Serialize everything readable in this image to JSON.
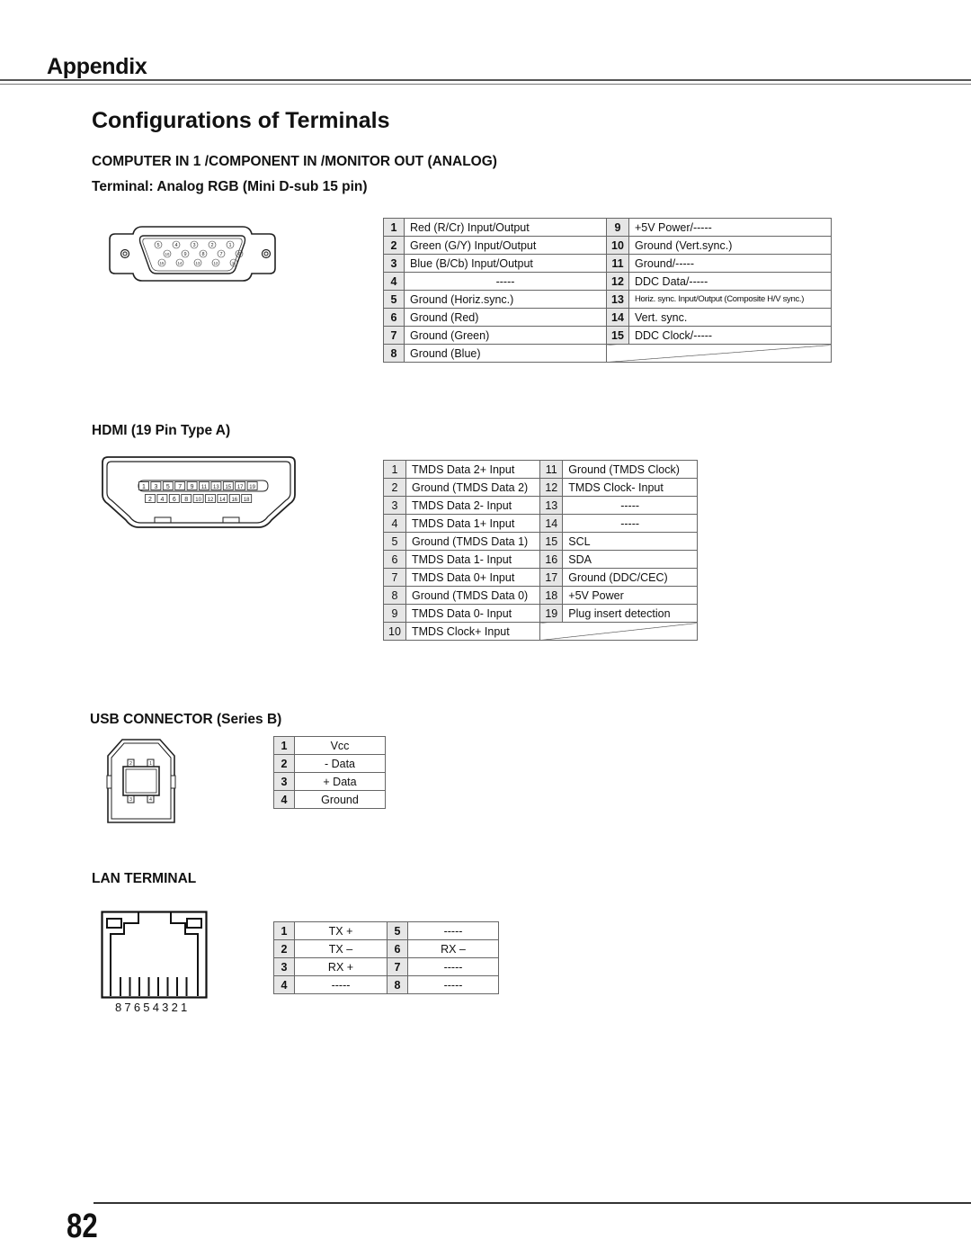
{
  "header": {
    "title": "Appendix"
  },
  "page": {
    "section_title": "Configurations of Terminals",
    "page_number": "82"
  },
  "vga": {
    "heading": "COMPUTER IN 1 /COMPONENT IN /MONITOR OUT (ANALOG)",
    "subheading": "Terminal: Analog RGB (Mini D-sub 15 pin)",
    "connector_icon": "vga-dsub15-connector-icon",
    "pin_labels_row1": [
      "5",
      "4",
      "3",
      "2",
      "1"
    ],
    "pin_labels_row2": [
      "10",
      "9",
      "8",
      "7",
      "6"
    ],
    "pin_labels_row3": [
      "15",
      "14",
      "13",
      "12",
      "11"
    ],
    "rows": [
      {
        "l_num": "1",
        "l_desc": "Red (R/Cr) Input/Output",
        "r_num": "9",
        "r_desc": "+5V Power/-----"
      },
      {
        "l_num": "2",
        "l_desc": "Green (G/Y) Input/Output",
        "r_num": "10",
        "r_desc": "Ground (Vert.sync.)"
      },
      {
        "l_num": "3",
        "l_desc": "Blue (B/Cb) Input/Output",
        "r_num": "11",
        "r_desc": "Ground/-----"
      },
      {
        "l_num": "4",
        "l_desc": "-----",
        "r_num": "12",
        "r_desc": "DDC Data/-----"
      },
      {
        "l_num": "5",
        "l_desc": "Ground (Horiz.sync.)",
        "r_num": "13",
        "r_desc": "Horiz. sync. Input/Output (Composite H/V sync.)"
      },
      {
        "l_num": "6",
        "l_desc": "Ground (Red)",
        "r_num": "14",
        "r_desc": "Vert. sync."
      },
      {
        "l_num": "7",
        "l_desc": "Ground (Green)",
        "r_num": "15",
        "r_desc": "DDC Clock/-----"
      },
      {
        "l_num": "8",
        "l_desc": "Ground (Blue)",
        "r_num": "",
        "r_desc": ""
      }
    ]
  },
  "hdmi": {
    "heading": "HDMI (19 Pin Type A)",
    "connector_icon": "hdmi-type-a-connector-icon",
    "pins_top": [
      "1",
      "3",
      "5",
      "7",
      "9",
      "11",
      "13",
      "15",
      "17",
      "19"
    ],
    "pins_bottom": [
      "2",
      "4",
      "6",
      "8",
      "10",
      "12",
      "14",
      "16",
      "18"
    ],
    "rows": [
      {
        "l_num": "1",
        "l_desc": "TMDS Data 2+  Input",
        "r_num": "11",
        "r_desc": "Ground (TMDS Clock)"
      },
      {
        "l_num": "2",
        "l_desc": "Ground (TMDS Data 2)",
        "r_num": "12",
        "r_desc": "TMDS Clock- Input"
      },
      {
        "l_num": "3",
        "l_desc": "TMDS Data 2- Input",
        "r_num": "13",
        "r_desc": "-----"
      },
      {
        "l_num": "4",
        "l_desc": "TMDS Data 1+ Input",
        "r_num": "14",
        "r_desc": "-----"
      },
      {
        "l_num": "5",
        "l_desc": "Ground (TMDS Data 1)",
        "r_num": "15",
        "r_desc": "SCL"
      },
      {
        "l_num": "6",
        "l_desc": "TMDS Data 1- Input",
        "r_num": "16",
        "r_desc": "SDA"
      },
      {
        "l_num": "7",
        "l_desc": "TMDS Data 0+ Input",
        "r_num": "17",
        "r_desc": "Ground (DDC/CEC)"
      },
      {
        "l_num": "8",
        "l_desc": "Ground (TMDS Data 0)",
        "r_num": "18",
        "r_desc": "+5V Power"
      },
      {
        "l_num": "9",
        "l_desc": "TMDS Data 0- Input",
        "r_num": "19",
        "r_desc": "Plug insert detection"
      },
      {
        "l_num": "10",
        "l_desc": "TMDS Clock+ Input",
        "r_num": "",
        "r_desc": ""
      }
    ]
  },
  "usb": {
    "heading": "USB CONNECTOR (Series B)",
    "connector_icon": "usb-type-b-connector-icon",
    "pin_labels": [
      "2",
      "1",
      "3",
      "4"
    ],
    "rows": [
      {
        "num": "1",
        "desc": "Vcc"
      },
      {
        "num": "2",
        "desc": "- Data"
      },
      {
        "num": "3",
        "desc": "+ Data"
      },
      {
        "num": "4",
        "desc": "Ground"
      }
    ]
  },
  "lan": {
    "heading": "LAN TERMINAL",
    "connector_icon": "rj45-connector-icon",
    "pin_order_label": "87654321",
    "rows": [
      {
        "l_num": "1",
        "l_desc": "TX +",
        "r_num": "5",
        "r_desc": "-----"
      },
      {
        "l_num": "2",
        "l_desc": "TX –",
        "r_num": "6",
        "r_desc": "RX –"
      },
      {
        "l_num": "3",
        "l_desc": "RX +",
        "r_num": "7",
        "r_desc": "-----"
      },
      {
        "l_num": "4",
        "l_desc": "-----",
        "r_num": "8",
        "r_desc": "-----"
      }
    ]
  }
}
